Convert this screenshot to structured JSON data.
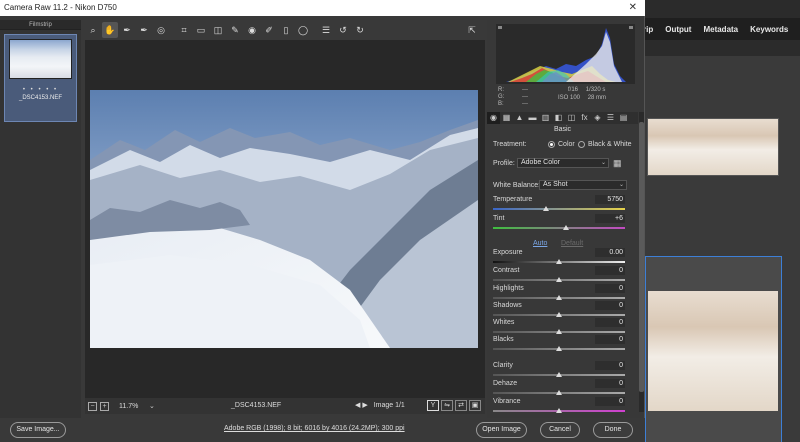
{
  "window": {
    "title": "Camera Raw 11.2  -  Nikon D750",
    "close_glyph": "✕"
  },
  "background_app": {
    "menu": [
      "rip",
      "Output",
      "Metadata",
      "Keywords"
    ]
  },
  "filmstrip": {
    "header": "Filmstrip",
    "rating": "• • • • •",
    "filename": "_DSC4153.NEF"
  },
  "toolbar": {
    "icons": [
      "zoom-icon",
      "hand-icon",
      "white-balance-icon",
      "color-sampler-icon",
      "targeted-adjustment-icon",
      "crop-icon",
      "straighten-icon",
      "transform-icon",
      "spot-removal-icon",
      "red-eye-icon",
      "adjustment-brush-icon",
      "graduated-filter-icon",
      "radial-filter-icon",
      "preferences-icon",
      "rotate-ccw-icon",
      "rotate-cw-icon"
    ],
    "glyphs": [
      "⌕",
      "✋",
      "✒",
      "✒",
      "◎",
      "⌗",
      "▭",
      "◫",
      "✎",
      "◉",
      "✐",
      "▯",
      "◯",
      "☰",
      "↺",
      "↻"
    ],
    "right_glyph": "⇱"
  },
  "canvas": {
    "zoom": "11.7%",
    "filename": "_DSC4153.NEF",
    "image_counter": "Image 1/1",
    "prev_arrow": "◀",
    "next_arrow": "▶"
  },
  "bottom": {
    "save_image": "Save Image...",
    "file_info": "Adobe RGB (1998); 8 bit; 6016 by 4016 (24.2MP); 300 ppi",
    "open_image": "Open Image",
    "cancel": "Cancel",
    "done": "Done"
  },
  "camera_info": {
    "r_label": "R:",
    "g_label": "G:",
    "b_label": "B:",
    "r_value": "---",
    "g_value": "---",
    "b_value": "---",
    "aperture": "f/16",
    "shutter": "1/320 s",
    "iso": "ISO 100",
    "focal": "28 mm"
  },
  "panel": {
    "section": "Basic",
    "tab_glyphs": [
      "◉",
      "▦",
      "▲",
      "▬",
      "▥",
      "◧",
      "◫",
      "fx",
      "◈",
      "☰",
      "▤"
    ],
    "treatment_label": "Treatment:",
    "color_option": "Color",
    "bw_option": "Black & White",
    "profile_label": "Profile:",
    "profile_value": "Adobe Color",
    "wb_label": "White Balance:",
    "wb_value": "As Shot",
    "auto": "Auto",
    "default": "Default",
    "sliders": [
      {
        "label": "Temperature",
        "value": "5750",
        "fraction": 0.4
      },
      {
        "label": "Tint",
        "value": "+6",
        "fraction": 0.55
      },
      {
        "label": "Exposure",
        "value": "0.00",
        "fraction": 0.5
      },
      {
        "label": "Contrast",
        "value": "0",
        "fraction": 0.5
      },
      {
        "label": "Highlights",
        "value": "0",
        "fraction": 0.5
      },
      {
        "label": "Shadows",
        "value": "0",
        "fraction": 0.5
      },
      {
        "label": "Whites",
        "value": "0",
        "fraction": 0.5
      },
      {
        "label": "Blacks",
        "value": "0",
        "fraction": 0.5
      },
      {
        "label": "Clarity",
        "value": "0",
        "fraction": 0.5
      },
      {
        "label": "Dehaze",
        "value": "0",
        "fraction": 0.5
      },
      {
        "label": "Vibrance",
        "value": "0",
        "fraction": 0.5
      }
    ]
  },
  "colors": {
    "accent_blue": "#3d7fd6",
    "panel_bg": "#383838",
    "canvas_bg": "#282828"
  }
}
